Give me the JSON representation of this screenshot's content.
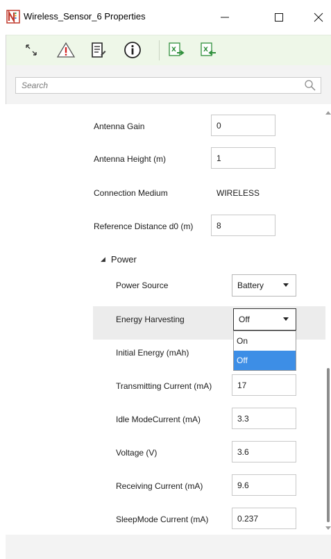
{
  "window": {
    "title": "Wireless_Sensor_6 Properties",
    "minimize_glyph": "—",
    "maximize_glyph": "☐",
    "close_glyph": "✕"
  },
  "toolbar": {
    "icons": [
      "expand-icon",
      "warning-icon",
      "notes-icon",
      "info-icon",
      "export-excel-icon",
      "import-excel-icon"
    ]
  },
  "search": {
    "placeholder": "Search",
    "value": ""
  },
  "properties": {
    "antenna_gain": {
      "label": "Antenna Gain",
      "value": "0"
    },
    "antenna_height": {
      "label": "Antenna Height (m)",
      "value": "1"
    },
    "connection_medium": {
      "label": "Connection Medium",
      "value": "WIRELESS"
    },
    "reference_distance": {
      "label": "Reference Distance d0 (m)",
      "value": "8"
    }
  },
  "power": {
    "header": "Power",
    "power_source": {
      "label": "Power Source",
      "value": "Battery"
    },
    "energy_harvesting": {
      "label": "Energy Harvesting",
      "value": "Off",
      "options": [
        "On",
        "Off"
      ],
      "selected_option": "Off"
    },
    "initial_energy": {
      "label": "Initial Energy (mAh)"
    },
    "transmitting_current": {
      "label": "Transmitting Current (mA)",
      "value": "17"
    },
    "idle_mode_current": {
      "label": "Idle ModeCurrent (mA)",
      "value": "3.3"
    },
    "voltage": {
      "label": "Voltage (V)",
      "value": "3.6"
    },
    "receiving_current": {
      "label": "Receiving Current (mA)",
      "value": "9.6"
    },
    "sleep_mode_current": {
      "label": "SleepMode Current (mA)",
      "value": "0.237"
    }
  },
  "colors": {
    "toolbar_bg": "#eef7e8",
    "selection_blue": "#3d8ee6",
    "warning_red": "#d42020",
    "excel_green": "#2f8f3b"
  }
}
